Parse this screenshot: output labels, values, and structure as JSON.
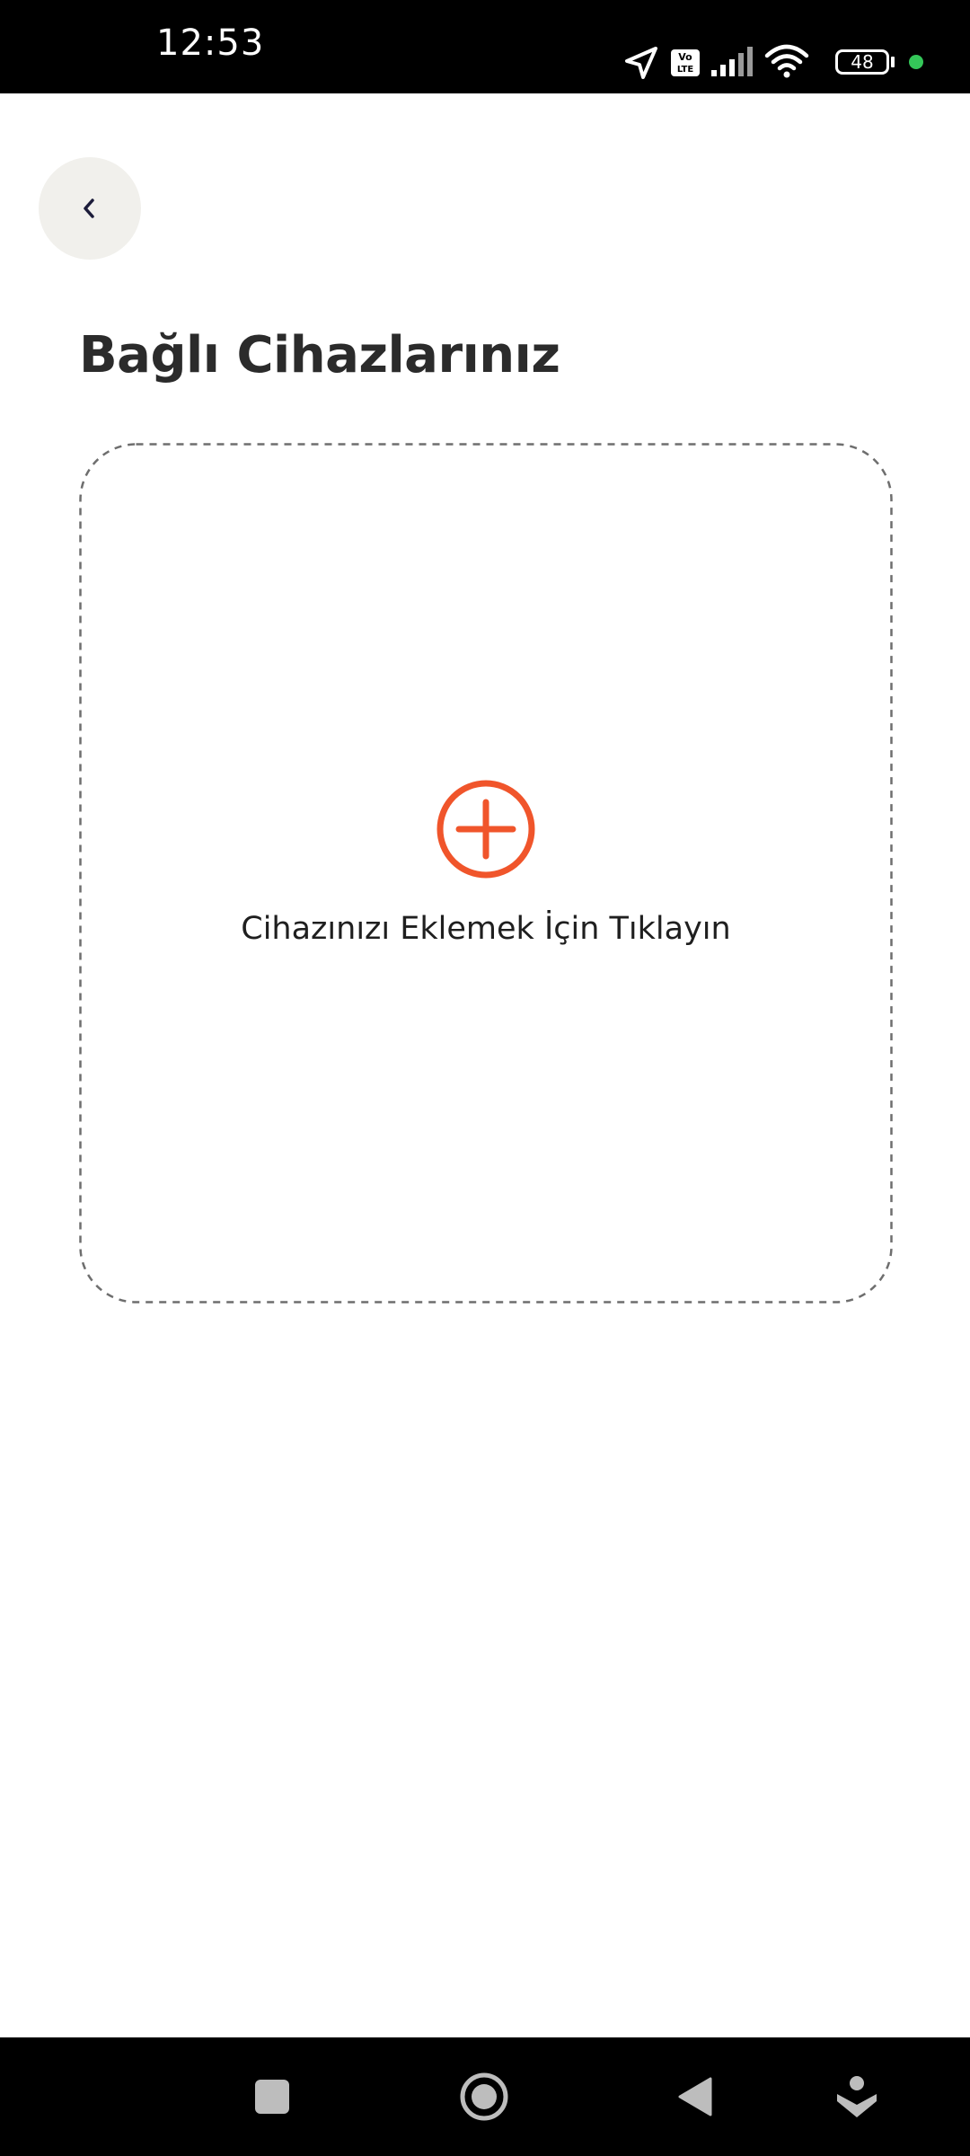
{
  "status_bar": {
    "time": "12:53",
    "battery_level": "48",
    "network_badge_top": "Vo",
    "network_badge_bottom": "LTE",
    "icons": [
      "location-arrow-icon",
      "volte-icon",
      "signal-icon",
      "wifi-icon",
      "battery-icon",
      "privacy-dot-icon"
    ],
    "dot_color": "#34c759"
  },
  "header": {
    "back_icon": "chevron-left-icon"
  },
  "main": {
    "title": "Bağlı Cihazlarınız",
    "add_device": {
      "icon": "plus-circle-icon",
      "label": "Cihazınızı Eklemek İçin Tıklayın",
      "accent_color": "#f0552b"
    }
  },
  "nav_bar": {
    "items": [
      "recents-square-icon",
      "home-circle-icon",
      "back-triangle-icon",
      "assistant-icon"
    ]
  }
}
